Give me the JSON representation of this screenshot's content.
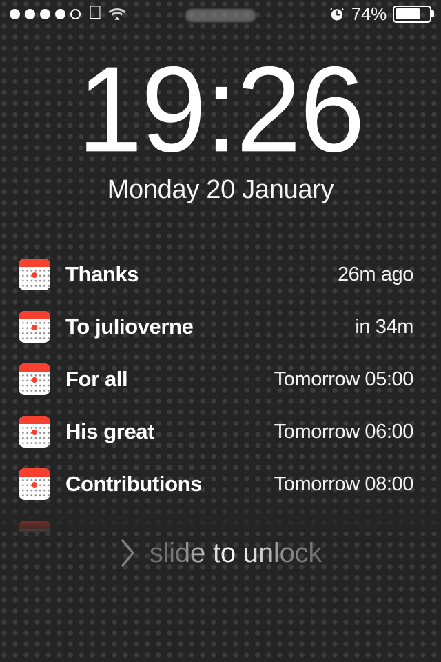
{
  "status_bar": {
    "signal": {
      "icon": "signal-dots",
      "bars_filled": 4,
      "bars_total": 5
    },
    "apple_logo": "",
    "wifi": {
      "icon": "wifi-icon",
      "strength": 3
    },
    "carrier": "",
    "alarm": {
      "icon": "alarm-clock-icon"
    },
    "battery_percent": "74%",
    "battery_level": 74
  },
  "clock": {
    "time": "19:26",
    "date": "Monday 20 January"
  },
  "notifications": [
    {
      "app_icon": "calendar-icon",
      "title": "Thanks",
      "time": "26m ago"
    },
    {
      "app_icon": "calendar-icon",
      "title": "To julioverne",
      "time": "in 34m"
    },
    {
      "app_icon": "calendar-icon",
      "title": "For all",
      "time": "Tomorrow 05:00"
    },
    {
      "app_icon": "calendar-icon",
      "title": "His great",
      "time": "Tomorrow 06:00"
    },
    {
      "app_icon": "calendar-icon",
      "title": "Contributions",
      "time": "Tomorrow 08:00"
    },
    {
      "app_icon": "calendar-icon",
      "title": "",
      "time": ""
    }
  ],
  "unlock": {
    "chevron": "chevron-right-icon",
    "label": "slide to unlock"
  },
  "colors": {
    "background": "#242424",
    "dot_pattern": "#3b3b3b",
    "accent_red": "#f93f2d",
    "text_primary": "#ffffff",
    "text_secondary": "#f2f2f2"
  }
}
